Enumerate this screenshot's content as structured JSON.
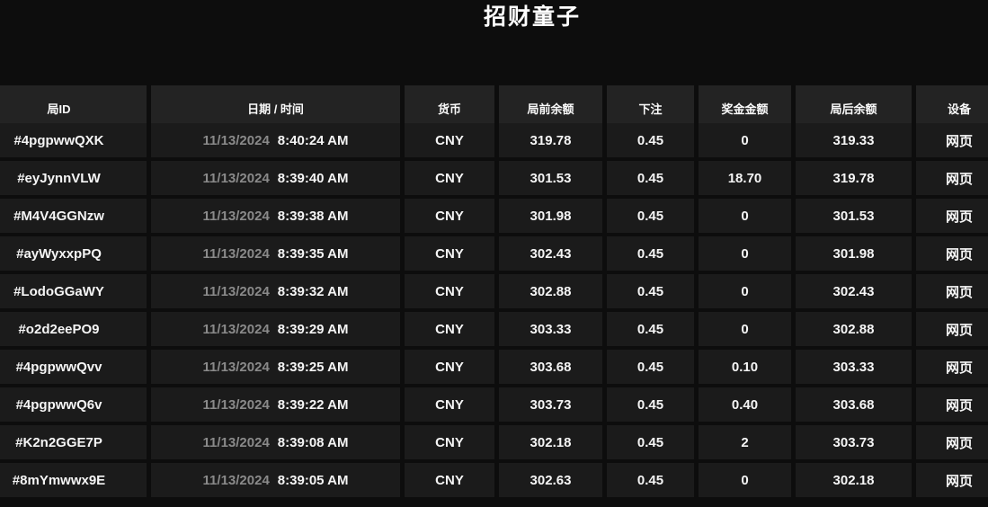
{
  "title": "招财童子",
  "colors": {
    "page_bg": "#0d0d0d",
    "header_bg": "#232323",
    "row_bg": "#1b1b1b",
    "date_dim_text": "#8a8a8a",
    "primary_text": "#ffffff"
  },
  "table": {
    "columns": [
      {
        "key": "round_id",
        "label": "局ID"
      },
      {
        "key": "datetime",
        "label": "日期 / 时间"
      },
      {
        "key": "currency",
        "label": "货币"
      },
      {
        "key": "balance_before",
        "label": "局前余额"
      },
      {
        "key": "bet",
        "label": "下注"
      },
      {
        "key": "prize",
        "label": "奖金金额"
      },
      {
        "key": "balance_after",
        "label": "局后余额"
      },
      {
        "key": "device",
        "label": "设备"
      }
    ],
    "rows": [
      {
        "round_id": "#4pgpwwQXK",
        "date": "11/13/2024",
        "time": "8:40:24 AM",
        "currency": "CNY",
        "balance_before": "319.78",
        "bet": "0.45",
        "prize": "0",
        "balance_after": "319.33",
        "device": "网页"
      },
      {
        "round_id": "#eyJynnVLW",
        "date": "11/13/2024",
        "time": "8:39:40 AM",
        "currency": "CNY",
        "balance_before": "301.53",
        "bet": "0.45",
        "prize": "18.70",
        "balance_after": "319.78",
        "device": "网页"
      },
      {
        "round_id": "#M4V4GGNzw",
        "date": "11/13/2024",
        "time": "8:39:38 AM",
        "currency": "CNY",
        "balance_before": "301.98",
        "bet": "0.45",
        "prize": "0",
        "balance_after": "301.53",
        "device": "网页"
      },
      {
        "round_id": "#ayWyxxpPQ",
        "date": "11/13/2024",
        "time": "8:39:35 AM",
        "currency": "CNY",
        "balance_before": "302.43",
        "bet": "0.45",
        "prize": "0",
        "balance_after": "301.98",
        "device": "网页"
      },
      {
        "round_id": "#LodoGGaWY",
        "date": "11/13/2024",
        "time": "8:39:32 AM",
        "currency": "CNY",
        "balance_before": "302.88",
        "bet": "0.45",
        "prize": "0",
        "balance_after": "302.43",
        "device": "网页"
      },
      {
        "round_id": "#o2d2eePO9",
        "date": "11/13/2024",
        "time": "8:39:29 AM",
        "currency": "CNY",
        "balance_before": "303.33",
        "bet": "0.45",
        "prize": "0",
        "balance_after": "302.88",
        "device": "网页"
      },
      {
        "round_id": "#4pgpwwQvv",
        "date": "11/13/2024",
        "time": "8:39:25 AM",
        "currency": "CNY",
        "balance_before": "303.68",
        "bet": "0.45",
        "prize": "0.10",
        "balance_after": "303.33",
        "device": "网页"
      },
      {
        "round_id": "#4pgpwwQ6v",
        "date": "11/13/2024",
        "time": "8:39:22 AM",
        "currency": "CNY",
        "balance_before": "303.73",
        "bet": "0.45",
        "prize": "0.40",
        "balance_after": "303.68",
        "device": "网页"
      },
      {
        "round_id": "#K2n2GGE7P",
        "date": "11/13/2024",
        "time": "8:39:08 AM",
        "currency": "CNY",
        "balance_before": "302.18",
        "bet": "0.45",
        "prize": "2",
        "balance_after": "303.73",
        "device": "网页"
      },
      {
        "round_id": "#8mYmwwx9E",
        "date": "11/13/2024",
        "time": "8:39:05 AM",
        "currency": "CNY",
        "balance_before": "302.63",
        "bet": "0.45",
        "prize": "0",
        "balance_after": "302.18",
        "device": "网页"
      }
    ]
  }
}
